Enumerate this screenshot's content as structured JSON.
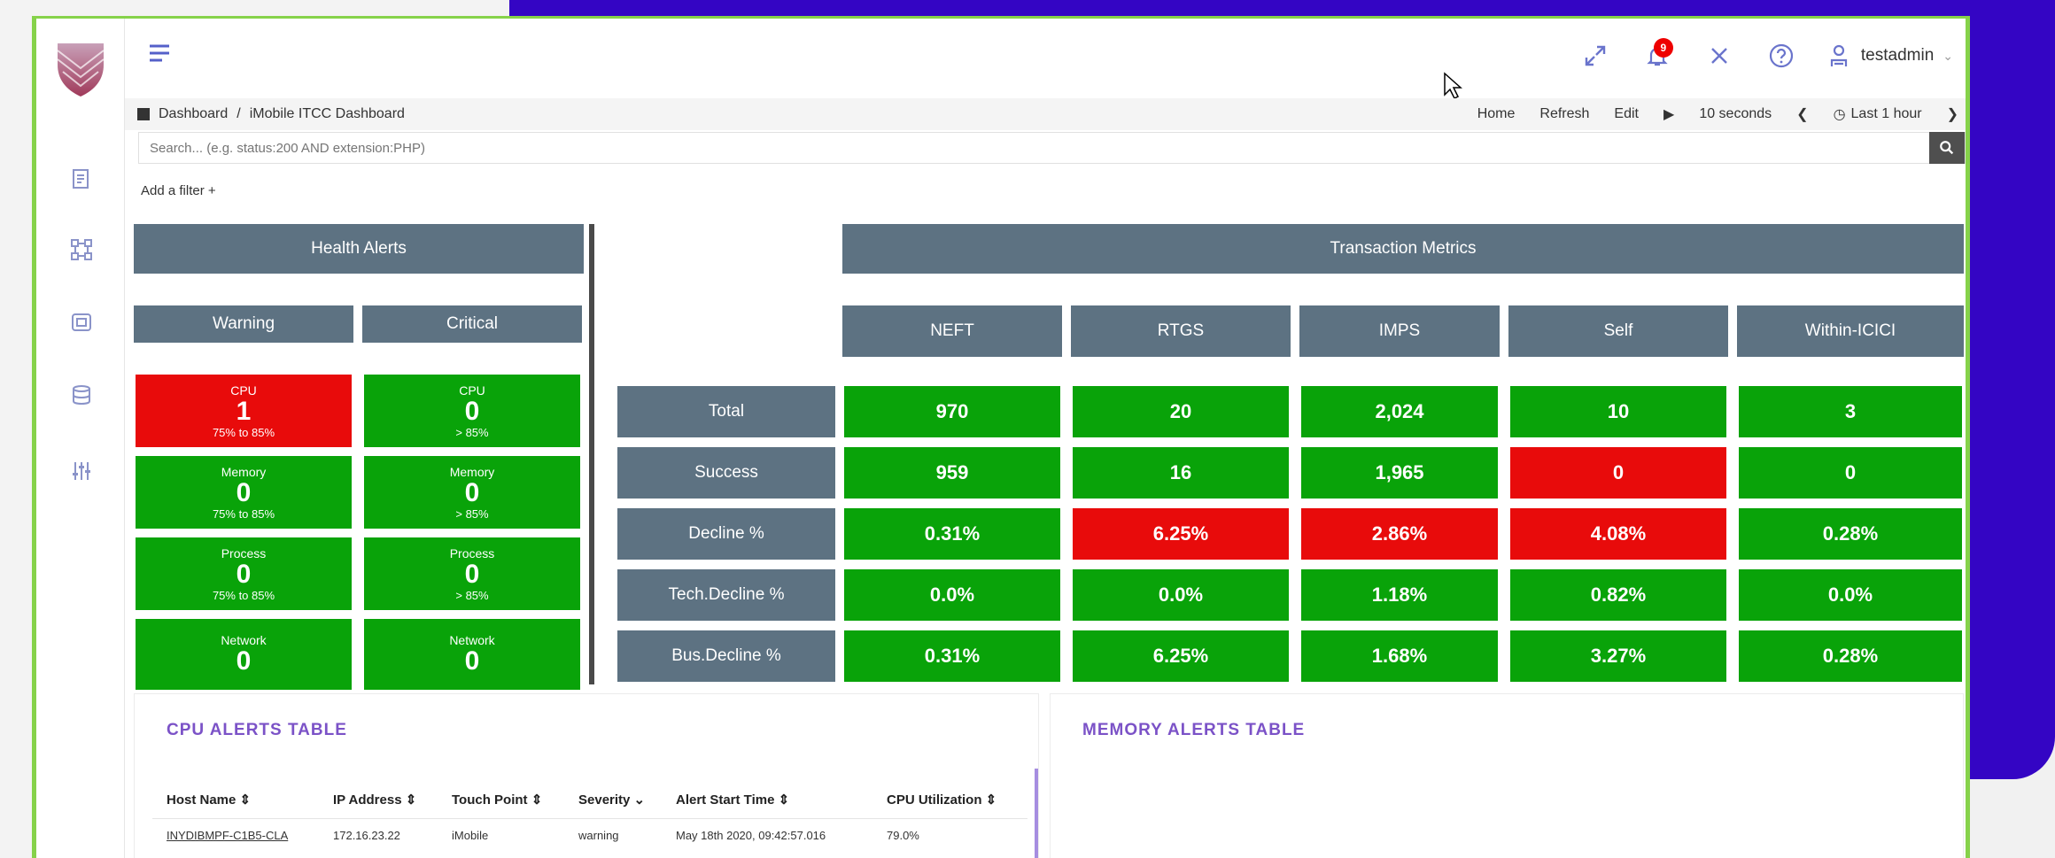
{
  "topbar": {
    "username": "testadmin",
    "notification_count": "9"
  },
  "breadcrumb": {
    "root": "Dashboard",
    "sep": "/",
    "current": "iMobile ITCC Dashboard"
  },
  "toolbar": {
    "home": "Home",
    "refresh": "Refresh",
    "edit": "Edit",
    "interval": "10 seconds",
    "time_range": "Last 1 hour"
  },
  "search": {
    "placeholder": "Search... (e.g. status:200 AND extension:PHP)"
  },
  "filter": {
    "add_label": "Add a filter +"
  },
  "health_alerts": {
    "title": "Health Alerts",
    "warning_label": "Warning",
    "critical_label": "Critical",
    "warning": [
      {
        "name": "CPU",
        "count": "1",
        "range": "75% to 85%",
        "status": "red"
      },
      {
        "name": "Memory",
        "count": "0",
        "range": "75% to 85%",
        "status": "green"
      },
      {
        "name": "Process",
        "count": "0",
        "range": "75% to 85%",
        "status": "green"
      },
      {
        "name": "Network",
        "count": "0",
        "range": "",
        "status": "green"
      }
    ],
    "critical": [
      {
        "name": "CPU",
        "count": "0",
        "range": "> 85%",
        "status": "green"
      },
      {
        "name": "Memory",
        "count": "0",
        "range": "> 85%",
        "status": "green"
      },
      {
        "name": "Process",
        "count": "0",
        "range": "> 85%",
        "status": "green"
      },
      {
        "name": "Network",
        "count": "0",
        "range": "",
        "status": "green"
      }
    ]
  },
  "transaction_metrics": {
    "title": "Transaction Metrics",
    "columns": [
      "NEFT",
      "RTGS",
      "IMPS",
      "Self",
      "Within-ICICI"
    ],
    "rows": [
      {
        "label": "Total",
        "values": [
          "970",
          "20",
          "2,024",
          "10",
          "3"
        ],
        "status": [
          "green",
          "green",
          "green",
          "green",
          "green"
        ]
      },
      {
        "label": "Success",
        "values": [
          "959",
          "16",
          "1,965",
          "0",
          "0"
        ],
        "status": [
          "green",
          "green",
          "green",
          "red",
          "green"
        ]
      },
      {
        "label": "Decline %",
        "values": [
          "0.31%",
          "6.25%",
          "2.86%",
          "4.08%",
          "0.28%"
        ],
        "status": [
          "green",
          "red",
          "red",
          "red",
          "green"
        ]
      },
      {
        "label": "Tech.Decline %",
        "values": [
          "0.0%",
          "0.0%",
          "1.18%",
          "0.82%",
          "0.0%"
        ],
        "status": [
          "green",
          "green",
          "green",
          "green",
          "green"
        ]
      },
      {
        "label": "Bus.Decline %",
        "values": [
          "0.31%",
          "6.25%",
          "1.68%",
          "3.27%",
          "0.28%"
        ],
        "status": [
          "green",
          "green",
          "green",
          "green",
          "green"
        ]
      }
    ]
  },
  "cpu_table": {
    "title": "CPU ALERTS TABLE",
    "headers": [
      "Host Name ⇕",
      "IP Address ⇕",
      "Touch Point ⇕",
      "Severity ⌄",
      "Alert Start Time ⇕",
      "CPU Utilization ⇕"
    ],
    "rows": [
      [
        "INYDIBMPF-C1B5-CLA",
        "172.16.23.22",
        "iMobile",
        "warning",
        "May 18th 2020, 09:42:57.016",
        "79.0%"
      ]
    ]
  },
  "memory_table": {
    "title": "MEMORY ALERTS TABLE"
  },
  "colors": {
    "green": "#09a309",
    "red": "#e80b0b",
    "header": "#5d7282",
    "accent": "#7b52c7",
    "brand_blue": "#3405c4"
  },
  "icons": {
    "sidebar": [
      "report-icon",
      "network-icon",
      "database-icon",
      "storage-icon",
      "sliders-icon"
    ],
    "topbar": [
      "expand-icon",
      "bell-icon",
      "close-icon",
      "help-icon",
      "user-icon"
    ]
  }
}
